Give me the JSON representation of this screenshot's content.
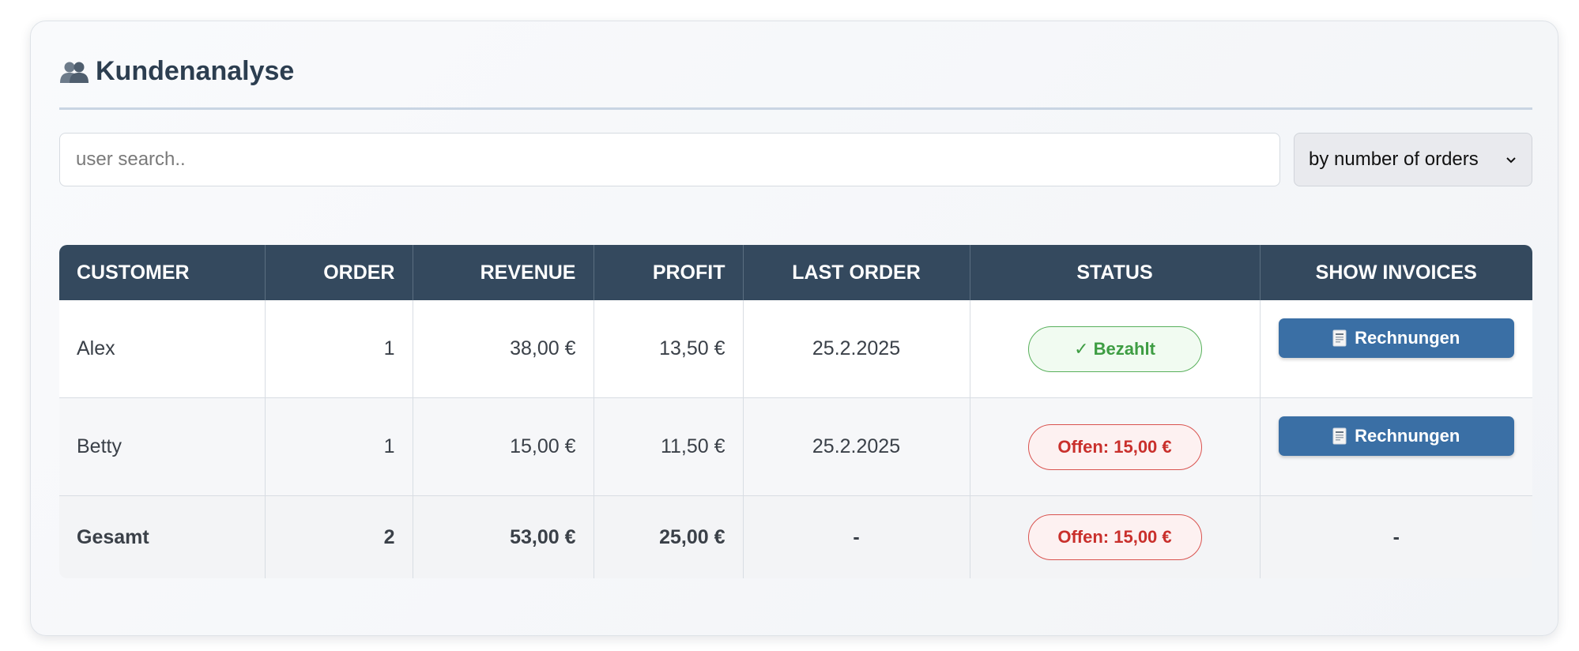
{
  "header": {
    "icon": "users-icon",
    "title": "Kundenanalyse"
  },
  "search": {
    "placeholder": "user search..",
    "value": ""
  },
  "sort": {
    "selected": "by number of orders"
  },
  "table": {
    "columns": [
      "CUSTOMER",
      "ORDER",
      "REVENUE",
      "PROFIT",
      "LAST ORDER",
      "STATUS",
      "SHOW INVOICES"
    ],
    "rows": [
      {
        "customer": "Alex",
        "orders": "1",
        "revenue": "38,00 €",
        "profit": "13,50 €",
        "last_order": "25.2.2025",
        "status": "✓ Bezahlt",
        "status_type": "paid",
        "invoice_label": "Rechnungen",
        "invoice_icon": "invoice-icon"
      },
      {
        "customer": "Betty",
        "orders": "1",
        "revenue": "15,00 €",
        "profit": "11,50 €",
        "last_order": "25.2.2025",
        "status": "Offen: 15,00 €",
        "status_type": "open",
        "invoice_label": "Rechnungen",
        "invoice_icon": "invoice-icon"
      }
    ],
    "total": {
      "customer": "Gesamt",
      "orders": "2",
      "revenue": "53,00 €",
      "profit": "25,00 €",
      "last_order": "-",
      "status": "Offen: 15,00 €",
      "status_type": "open",
      "invoices": "-"
    }
  },
  "colors": {
    "header_bg": "#34495e",
    "button_bg": "#3a6fa5",
    "paid": "#3e9d43",
    "open": "#c9302c"
  }
}
